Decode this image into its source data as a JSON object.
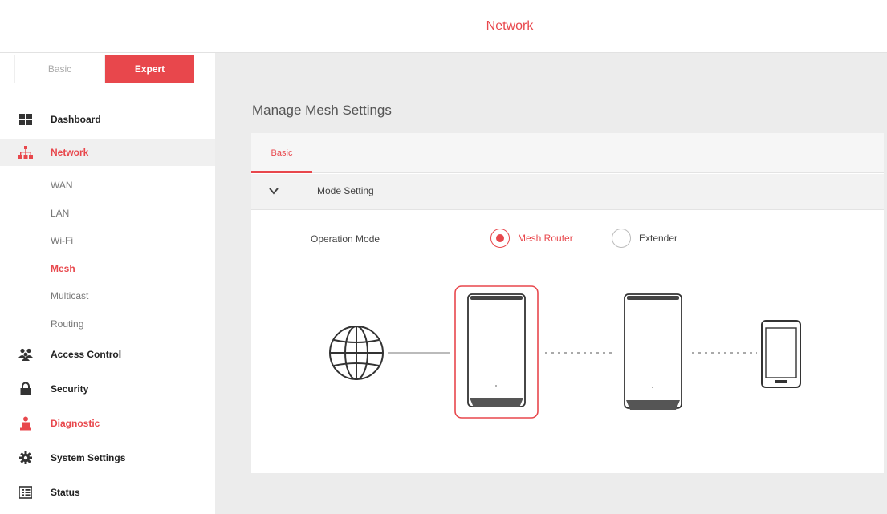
{
  "header": {
    "title": "Network"
  },
  "mode_toggle": {
    "basic_label": "Basic",
    "expert_label": "Expert",
    "selected": "Expert"
  },
  "sidebar": {
    "items": [
      {
        "label": "Dashboard",
        "icon": "dashboard-grid-icon"
      },
      {
        "label": "Network",
        "icon": "network-topology-icon",
        "active": true
      },
      {
        "label": "Access Control",
        "icon": "users-icon"
      },
      {
        "label": "Security",
        "icon": "lock-icon"
      },
      {
        "label": "Diagnostic",
        "icon": "diagnostic-person-icon"
      },
      {
        "label": "System Settings",
        "icon": "gear-icon"
      },
      {
        "label": "Status",
        "icon": "status-list-icon"
      }
    ],
    "network_subitems": [
      {
        "label": "WAN"
      },
      {
        "label": "LAN"
      },
      {
        "label": "Wi-Fi"
      },
      {
        "label": "Mesh",
        "active": true
      },
      {
        "label": "Multicast"
      },
      {
        "label": "Routing"
      }
    ]
  },
  "main": {
    "page_title": "Manage Mesh Settings",
    "tabs": [
      {
        "label": "Basic",
        "active": true
      }
    ],
    "section": {
      "title": "Mode Setting",
      "expanded": true
    },
    "operation_mode": {
      "label": "Operation Mode",
      "options": [
        {
          "label": "Mesh Router",
          "checked": true
        },
        {
          "label": "Extender",
          "checked": false
        }
      ]
    },
    "diagram": {
      "nodes": [
        "globe-icon",
        "mesh-router-device",
        "extender-device",
        "smartphone-icon"
      ],
      "highlighted_node": "mesh-router-device"
    }
  },
  "colors": {
    "accent": "#e8474c",
    "main_bg": "#ececec",
    "text": "#333333"
  }
}
